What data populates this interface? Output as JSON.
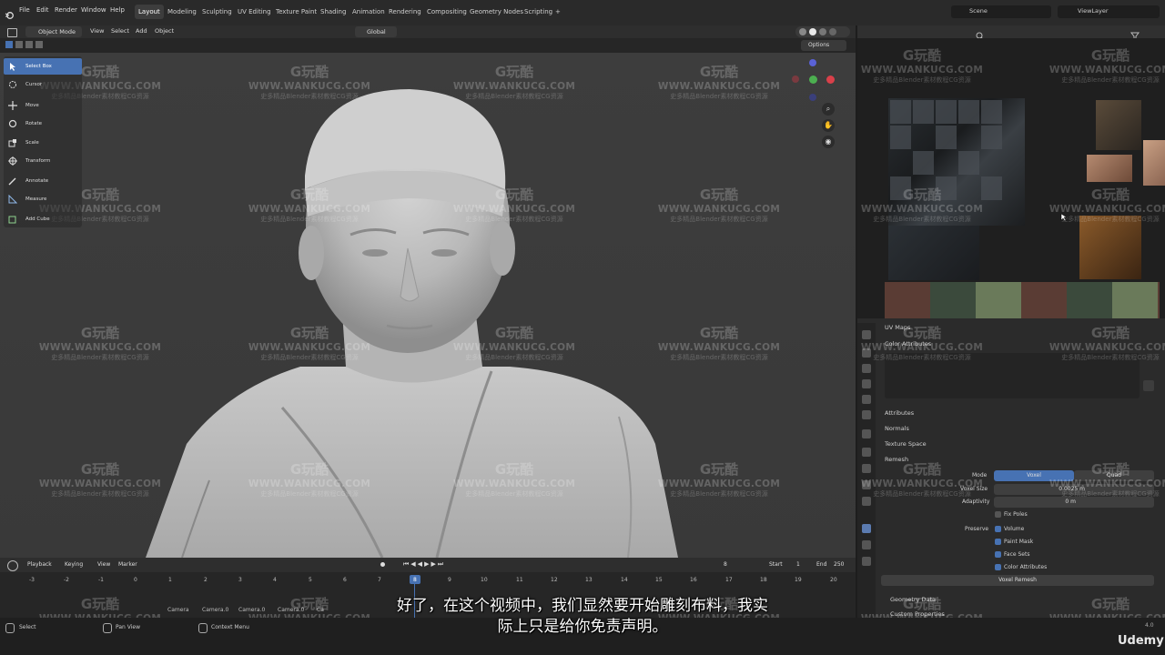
{
  "topbar": {
    "menus": [
      "File",
      "Edit",
      "Render",
      "Window",
      "Help"
    ],
    "workspaces": [
      "Layout",
      "Modeling",
      "Sculpting",
      "UV Editing",
      "Texture Paint",
      "Shading",
      "Animation",
      "Rendering",
      "Compositing",
      "Geometry Nodes",
      "Scripting"
    ],
    "active_workspace": "Layout",
    "add_tab": "+",
    "scene_label": "Scene",
    "view_layer_label": "ViewLayer"
  },
  "viewport_header": {
    "mode": "Object Mode",
    "menus": [
      "View",
      "Select",
      "Add",
      "Object"
    ],
    "orientation": "Global",
    "options": "Options"
  },
  "toolbar": {
    "tools": [
      {
        "label": "Select Box",
        "icon": "select-box-icon"
      },
      {
        "label": "Cursor",
        "icon": "cursor-icon"
      },
      {
        "label": "Move",
        "icon": "move-icon"
      },
      {
        "label": "Rotate",
        "icon": "rotate-icon"
      },
      {
        "label": "Scale",
        "icon": "scale-icon"
      },
      {
        "label": "Transform",
        "icon": "transform-icon"
      },
      {
        "label": "Annotate",
        "icon": "annotate-icon"
      },
      {
        "label": "Measure",
        "icon": "measure-icon"
      },
      {
        "label": "Add Cube",
        "icon": "add-cube-icon"
      }
    ]
  },
  "properties": {
    "uv_maps": "UV Maps",
    "color_attributes": "Color Attributes",
    "sections": [
      "Attributes",
      "Normals",
      "Texture Space"
    ],
    "remesh": "Remesh",
    "mode_label": "Mode",
    "mode_active": "Voxel",
    "mode_other": "Quad",
    "voxel_size_label": "Voxel Size",
    "voxel_size_value": "0.0025 m",
    "adaptivity_label": "Adaptivity",
    "adaptivity_value": "0 m",
    "fix_poles": "Fix Poles",
    "preserve_label": "Preserve",
    "preserve_items": [
      "Volume",
      "Paint Mask",
      "Face Sets",
      "Color Attributes"
    ],
    "voxel_remesh_button": "Voxel Remesh",
    "geometry_data": "Geometry Data",
    "custom_properties": "Custom Properties"
  },
  "timeline": {
    "menus": [
      "Playback",
      "Keying",
      "View",
      "Marker"
    ],
    "current_frame": "8",
    "start_label": "Start",
    "start_value": "1",
    "end_label": "End",
    "end_value": "250",
    "ticks": [
      "-3",
      "-2",
      "-1",
      "0",
      "1",
      "2",
      "3",
      "4",
      "5",
      "6",
      "7",
      "8",
      "9",
      "10",
      "11",
      "12",
      "13",
      "14",
      "15",
      "16",
      "17",
      "18",
      "19",
      "20"
    ],
    "markers": [
      "Camera",
      "Camera.0",
      "Camera.0",
      "Camera.0",
      "Ca"
    ]
  },
  "statusbar": {
    "select": "Select",
    "pan_view": "Pan View",
    "context_menu": "Context Menu",
    "version": "4.0",
    "brand": "Udemy"
  },
  "subtitle": {
    "line1": "好了，在这个视频中，我们显然要开始雕刻布料，我实",
    "line2": "际上只是给你免责声明。"
  },
  "watermark": {
    "logo": "G玩酷",
    "url": "WWW.WANKUCG.COM",
    "tagline": "史多精品Blender素材教程CG资源"
  },
  "colors": {
    "accent": "#4772b3",
    "viewport_bg": "#3d3d3d",
    "panel_bg": "#2b2b2b"
  }
}
